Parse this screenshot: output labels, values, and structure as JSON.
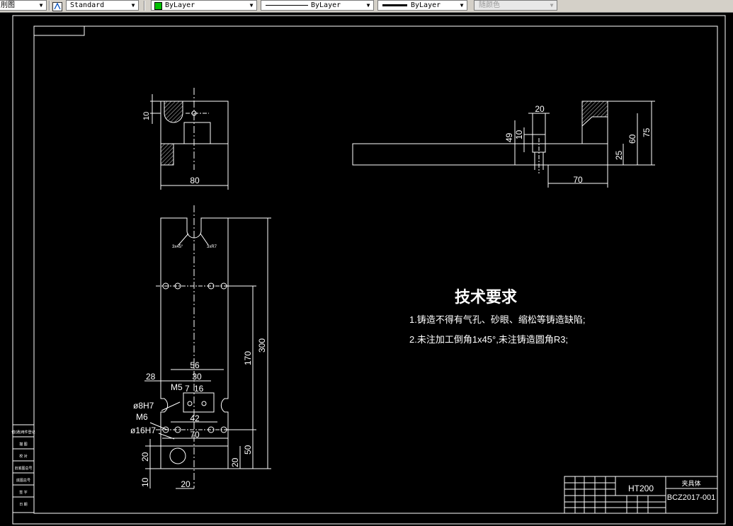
{
  "toolbar": {
    "view_label": "刖图",
    "text_style": "Standard",
    "layer": "ByLayer",
    "linetype": "ByLayer",
    "lineweight": "ByLayer",
    "plot_style": "随颜色",
    "layer_color": "#00c000"
  },
  "drawing": {
    "top_view_dims": {
      "width_80": "80",
      "height_10": "10"
    },
    "side_view_dims": {
      "d20": "20",
      "d10": "10",
      "d49": "49",
      "d70": "70",
      "d25": "25",
      "d60": "60",
      "d75": "75"
    },
    "front_view_dims": {
      "d300": "300",
      "d170": "170",
      "d50": "50",
      "d20_right": "20",
      "d56": "56",
      "d30": "30",
      "d28": "28",
      "d7": "7",
      "d16": "16",
      "m5": "M5",
      "phi8": "ø8H7",
      "m6": "M6",
      "d42": "42",
      "d70": "70",
      "phi16": "ø16H7",
      "d20_left": "20",
      "d10_left": "10",
      "d20_bottom": "20",
      "note_left": "3x45°",
      "note_right": "3xR7"
    },
    "tech_req": {
      "title": "技术要求",
      "line1": "1.铸造不得有气孔、砂眼、缩松等铸造缺陷;",
      "line2": "2.未注加工倒角1x45°,未注铸造圆角R3;"
    },
    "title_block": {
      "material": "HT200",
      "part_name": "夹具体",
      "drawing_no": "BCZ2017-001"
    },
    "side_stamp": [
      "借(通)用件登记",
      "描  图",
      "校  对",
      "旧底图总号",
      "底图总号",
      "签  字",
      "日  期"
    ]
  }
}
